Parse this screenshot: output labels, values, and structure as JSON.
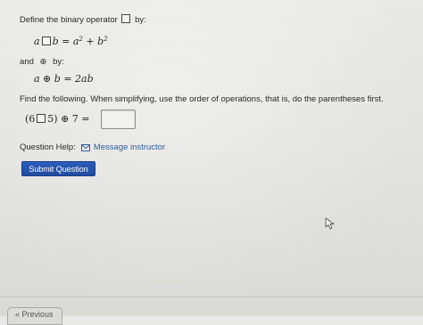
{
  "problem": {
    "define_prefix": "Define the binary operator",
    "define_suffix": "by:",
    "def1": {
      "lhs_a": "a",
      "lhs_b": "b",
      "equals": "=",
      "term1": "a",
      "exp1": "2",
      "plus": "+",
      "term2": "b",
      "exp2": "2"
    },
    "and_prefix": "and",
    "and_suffix": "by:",
    "circled_plus": "⊕",
    "def2": {
      "lhs": "a ⊕ b",
      "equals": "=",
      "rhs": "2ab"
    },
    "instructions": "Find the following.  When simplifying, use the order of operations, that is, do the parentheses first.",
    "expression": {
      "open": "(6",
      "close": "5)",
      "op": "⊕ 7 ="
    },
    "answer_value": ""
  },
  "help": {
    "label": "Question Help:",
    "link_text": "Message instructor"
  },
  "submit": {
    "label": "Submit Question"
  },
  "bottom_tab": {
    "label": "« Previous"
  }
}
